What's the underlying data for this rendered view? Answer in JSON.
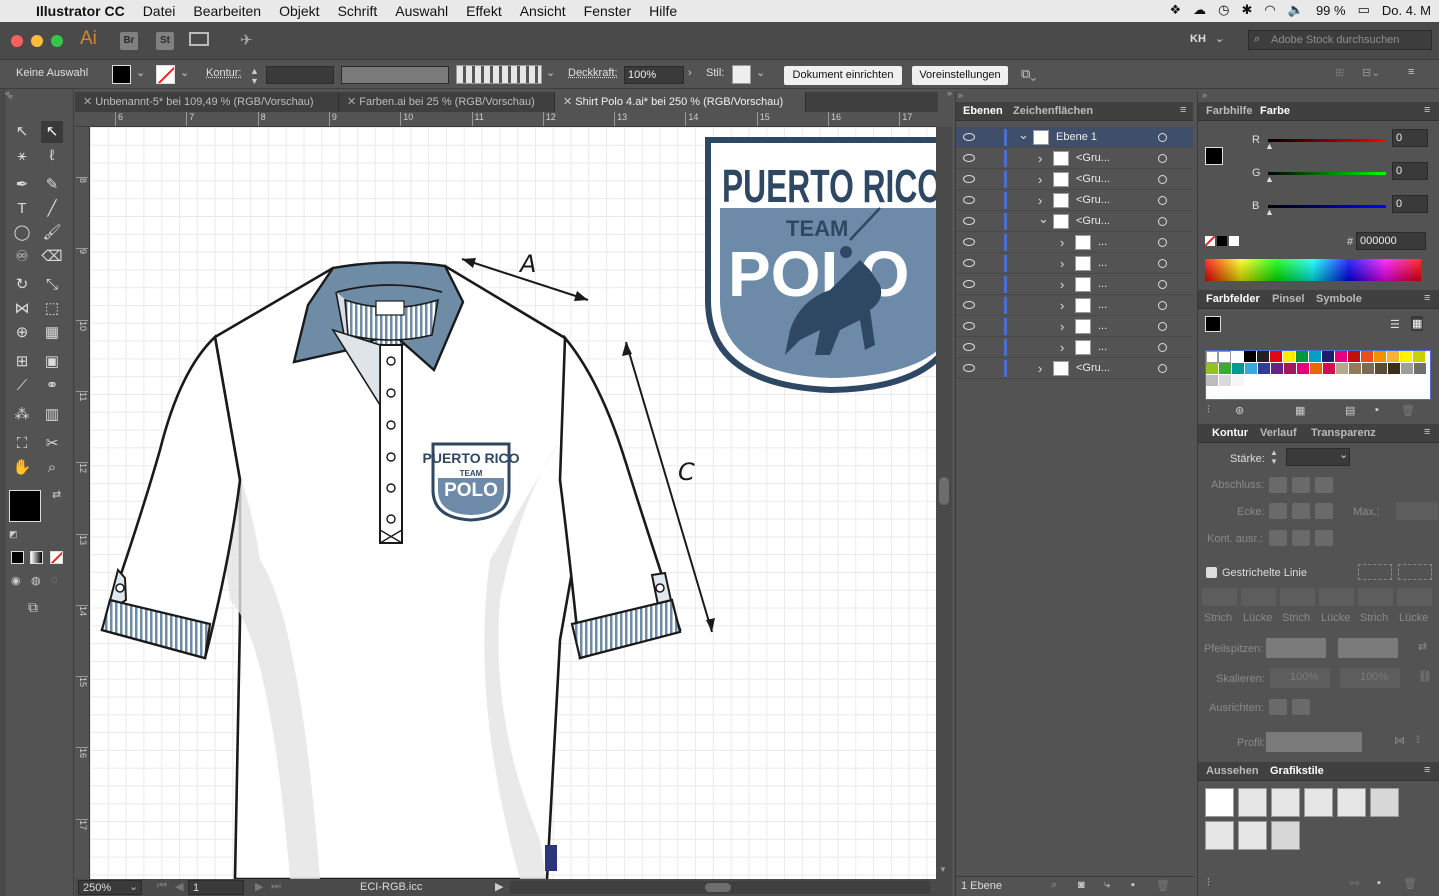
{
  "menubar": {
    "apple": "",
    "app": "Illustrator CC",
    "items": [
      "Datei",
      "Bearbeiten",
      "Objekt",
      "Schrift",
      "Auswahl",
      "Effekt",
      "Ansicht",
      "Fenster",
      "Hilfe"
    ],
    "battery": "99 %",
    "clock": "Do. 4. M"
  },
  "appbar": {
    "ai_logo": "Ai",
    "bridge": "Br",
    "stock": "St",
    "user": "KH",
    "stock_search_placeholder": "Adobe Stock durchsuchen"
  },
  "control": {
    "selection": "Keine Auswahl",
    "stroke_label": "Kontur:",
    "opacity_label": "Deckkraft:",
    "opacity_value": "100%",
    "style_label": "Stil:",
    "doc_setup": "Dokument einrichten",
    "preferences": "Voreinstellungen"
  },
  "tabs": [
    {
      "label": "Unbenannt-5* bei 109,49 % (RGB/Vorschau)"
    },
    {
      "label": "Farben.ai bei 25 % (RGB/Vorschau)"
    },
    {
      "label": "Shirt Polo 4.ai* bei 250 % (RGB/Vorschau)"
    }
  ],
  "ruler_h": [
    "6",
    "7",
    "8",
    "9",
    "10",
    "11",
    "12",
    "13",
    "14",
    "15",
    "16",
    "17"
  ],
  "ruler_v": [
    "8",
    "9",
    "10",
    "11",
    "12",
    "13",
    "14",
    "15",
    "16",
    "17"
  ],
  "canvas": {
    "label_a": "A",
    "label_c": "C",
    "logo_line1": "PUERTO RICO",
    "logo_line2": "TEAM",
    "logo_line3": "POLO"
  },
  "status": {
    "zoom": "250%",
    "page": "1",
    "profile": "ECI-RGB.icc"
  },
  "layers": {
    "tabs": [
      "Ebenen",
      "Zeichenflächen"
    ],
    "rows": [
      {
        "name": "Ebene 1",
        "level": 0,
        "expanded": true
      },
      {
        "name": "<Gru...",
        "level": 1
      },
      {
        "name": "<Gru...",
        "level": 1
      },
      {
        "name": "<Gru...",
        "level": 1
      },
      {
        "name": "<Gru...",
        "level": 1,
        "expanded": true
      },
      {
        "name": "...",
        "level": 2
      },
      {
        "name": "...",
        "level": 2
      },
      {
        "name": "...",
        "level": 2
      },
      {
        "name": "...",
        "level": 2
      },
      {
        "name": "...",
        "level": 2
      },
      {
        "name": "...",
        "level": 2
      },
      {
        "name": "<Gru...",
        "level": 1
      }
    ],
    "footer": "1 Ebene"
  },
  "color": {
    "tabs": [
      "Farbhilfe",
      "Farbe"
    ],
    "r_label": "R",
    "g_label": "G",
    "b_label": "B",
    "r": "0",
    "g": "0",
    "b": "0",
    "hex_label": "#",
    "hex": "000000"
  },
  "swatches": {
    "tabs": [
      "Farbfelder",
      "Pinsel",
      "Symbole"
    ],
    "colors": [
      "#ffffff",
      "#000000",
      "#222222",
      "#e30613",
      "#ffed00",
      "#009640",
      "#00a0c6",
      "#1d1d6a",
      "#e6007e",
      "#c00d0d",
      "#e94e1b",
      "#f39200",
      "#f8b133",
      "#fff200",
      "#c9d200",
      "#95c11f",
      "#3aaa35",
      "#009a93",
      "#36a9e1",
      "#2d3e94",
      "#662483",
      "#a3195b",
      "#e5007d",
      "#ec6608",
      "#d60b51",
      "#b5a989",
      "#8f7d5a",
      "#7c6b52",
      "#5b4a35",
      "#3c2e1e",
      "#9d9d9c",
      "#706f6f",
      "#bcbcbc",
      "#dadada",
      "#f6f6f6"
    ]
  },
  "stroke": {
    "tabs": [
      "Kontur",
      "Verlauf",
      "Transparenz"
    ],
    "weight_label": "Stärke:",
    "cap_label": "Abschluss:",
    "corner_label": "Ecke:",
    "limit_label": "Max.:",
    "align_label": "Kont. ausr.:",
    "dashed_label": "Gestrichelte Linie",
    "dash_labels": [
      "Strich",
      "Lücke",
      "Strich",
      "Lücke",
      "Strich",
      "Lücke"
    ],
    "arrows_label": "Pfeilspitzen:",
    "scale_label": "Skalieren:",
    "scale_val1": "100%",
    "scale_val2": "100%",
    "align2_label": "Ausrichten:",
    "profile_label": "Profil:"
  },
  "appearance": {
    "tabs": [
      "Aussehen",
      "Grafikstile"
    ]
  },
  "colors": {
    "shirt_stroke": "#1a1a1a",
    "collar": "#6f8ca7",
    "logo_navy": "#2e4763",
    "logo_blue": "#6d8aa8",
    "selection_blue": "#4a6fd0"
  }
}
